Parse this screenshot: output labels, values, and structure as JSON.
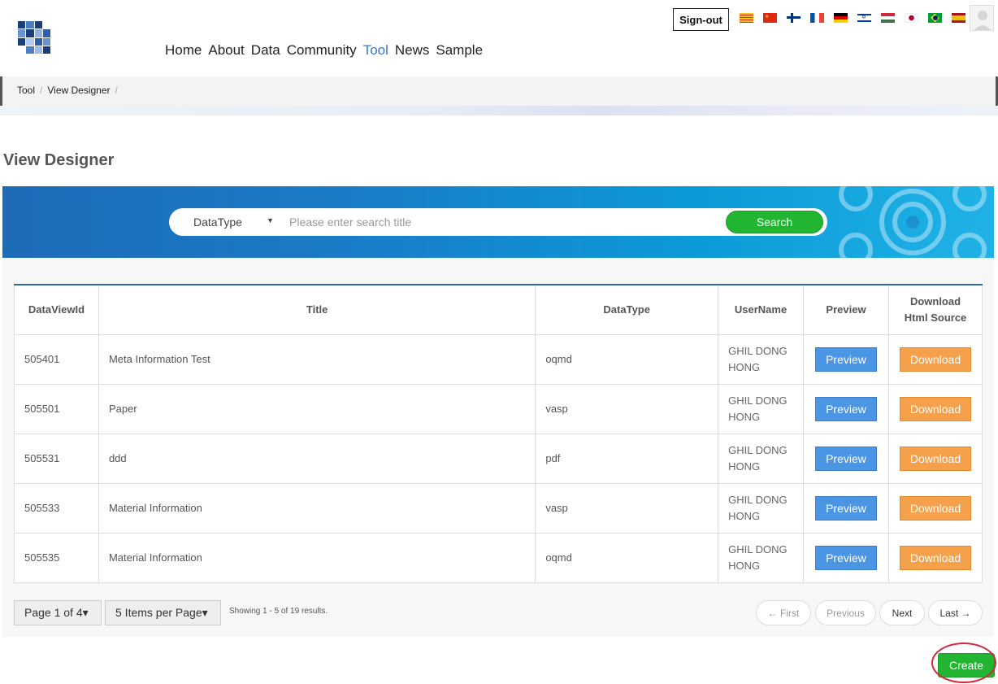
{
  "header": {
    "nav": [
      "Home",
      "About",
      "Data",
      "Community",
      "Tool",
      "News",
      "Sample"
    ],
    "active_nav": "Tool",
    "signout_label": "Sign-out",
    "flags": [
      "catalan-flag",
      "china-flag",
      "finland-flag",
      "france-flag",
      "germany-flag",
      "israel-flag",
      "hungary-flag",
      "japan-flag",
      "brazil-flag",
      "spain-flag"
    ]
  },
  "breadcrumb": [
    "Tool",
    "View Designer",
    ""
  ],
  "page_title": "View Designer",
  "search": {
    "datatype_label": "DataType",
    "placeholder": "Please enter search title",
    "button_label": "Search"
  },
  "table": {
    "headers": [
      "DataViewId",
      "Title",
      "DataType",
      "UserName",
      "Preview",
      "Download\nHtml Source"
    ],
    "rows": [
      {
        "id": "505401",
        "title": "Meta Information Test",
        "datatype": "oqmd",
        "user": "GHIL DONG\nHONG",
        "preview": "Preview",
        "download": "Download"
      },
      {
        "id": "505501",
        "title": "Paper",
        "datatype": "vasp",
        "user": "GHIL DONG\nHONG",
        "preview": "Preview",
        "download": "Download"
      },
      {
        "id": "505531",
        "title": "ddd",
        "datatype": "pdf",
        "user": "GHIL DONG\nHONG",
        "preview": "Preview",
        "download": "Download"
      },
      {
        "id": "505533",
        "title": "Material Information",
        "datatype": "vasp",
        "user": "GHIL DONG\nHONG",
        "preview": "Preview",
        "download": "Download"
      },
      {
        "id": "505535",
        "title": "Material Information",
        "datatype": "oqmd",
        "user": "GHIL DONG\nHONG",
        "preview": "Preview",
        "download": "Download"
      }
    ]
  },
  "pager": {
    "page_label": "Page 1 of 4▾",
    "per_page_label": "5 Items per Page▾",
    "showing": "Showing 1 - 5 of 19 results.",
    "first": "← First",
    "previous": "Previous",
    "next": "Next",
    "last": "Last →"
  },
  "create_label": "Create",
  "colors": {
    "accent_blue": "#3a78c2",
    "search_green": "#21b531",
    "preview_blue": "#4a95e4",
    "download_orange": "#f5a04a",
    "highlight_red": "#d0283c"
  }
}
